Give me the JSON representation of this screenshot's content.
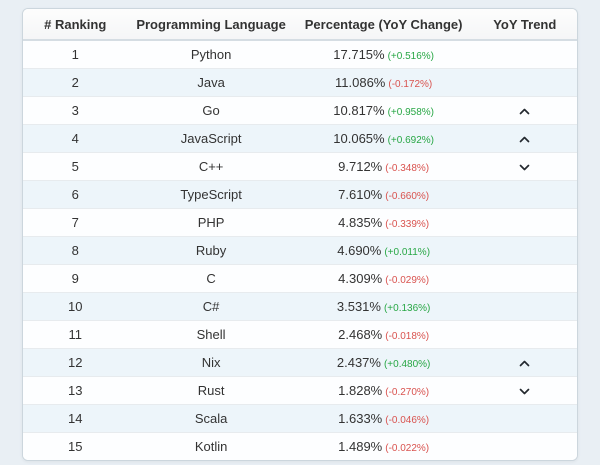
{
  "table": {
    "columns": [
      "# Ranking",
      "Programming Language",
      "Percentage (YoY Change)",
      "YoY Trend"
    ],
    "rows": [
      {
        "rank": "1",
        "language": "Python",
        "percentage": "17.715%",
        "change": "(+0.516%)",
        "trend": ""
      },
      {
        "rank": "2",
        "language": "Java",
        "percentage": "11.086%",
        "change": "(-0.172%)",
        "trend": ""
      },
      {
        "rank": "3",
        "language": "Go",
        "percentage": "10.817%",
        "change": "(+0.958%)",
        "trend": "up"
      },
      {
        "rank": "4",
        "language": "JavaScript",
        "percentage": "10.065%",
        "change": "(+0.692%)",
        "trend": "up"
      },
      {
        "rank": "5",
        "language": "C++",
        "percentage": "9.712%",
        "change": "(-0.348%)",
        "trend": "down"
      },
      {
        "rank": "6",
        "language": "TypeScript",
        "percentage": "7.610%",
        "change": "(-0.660%)",
        "trend": ""
      },
      {
        "rank": "7",
        "language": "PHP",
        "percentage": "4.835%",
        "change": "(-0.339%)",
        "trend": ""
      },
      {
        "rank": "8",
        "language": "Ruby",
        "percentage": "4.690%",
        "change": "(+0.011%)",
        "trend": ""
      },
      {
        "rank": "9",
        "language": "C",
        "percentage": "4.309%",
        "change": "(-0.029%)",
        "trend": ""
      },
      {
        "rank": "10",
        "language": "C#",
        "percentage": "3.531%",
        "change": "(+0.136%)",
        "trend": ""
      },
      {
        "rank": "11",
        "language": "Shell",
        "percentage": "2.468%",
        "change": "(-0.018%)",
        "trend": ""
      },
      {
        "rank": "12",
        "language": "Nix",
        "percentage": "2.437%",
        "change": "(+0.480%)",
        "trend": "up"
      },
      {
        "rank": "13",
        "language": "Rust",
        "percentage": "1.828%",
        "change": "(-0.270%)",
        "trend": "down"
      },
      {
        "rank": "14",
        "language": "Scala",
        "percentage": "1.633%",
        "change": "(-0.046%)",
        "trend": ""
      },
      {
        "rank": "15",
        "language": "Kotlin",
        "percentage": "1.489%",
        "change": "(-0.022%)",
        "trend": ""
      }
    ]
  },
  "icons": {
    "trend_up": "chevron-up",
    "trend_down": "chevron-down"
  },
  "colors": {
    "positive_change": "#28a745",
    "negative_change": "#d9534f",
    "stripe_row": "#edf5fa",
    "page_background": "#e9eff4",
    "trend_icon": "#24292f"
  }
}
